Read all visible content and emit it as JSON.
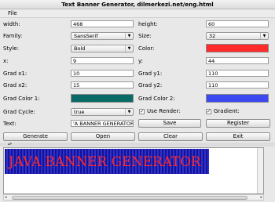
{
  "window": {
    "title": "Text Banner Generator, dilmerkezi.net/eng.html"
  },
  "menu": {
    "file": "File"
  },
  "form": {
    "width": {
      "label": "width:",
      "value": "468"
    },
    "height": {
      "label": "height:",
      "value": "60"
    },
    "family": {
      "label": "Family:",
      "value": "SansSerif"
    },
    "size": {
      "label": "Size:",
      "value": "32"
    },
    "style": {
      "label": "Style:",
      "value": "Bold"
    },
    "color": {
      "label": "Color:",
      "hex": "#ff2a2a"
    },
    "x": {
      "label": "x:",
      "value": "9"
    },
    "y": {
      "label": "y:",
      "value": "44"
    },
    "grad_x1": {
      "label": "Grad x1:",
      "value": "10"
    },
    "grad_y1": {
      "label": "Grad y1:",
      "value": "110"
    },
    "grad_x2": {
      "label": "Grad x2:",
      "value": "15"
    },
    "grad_y2": {
      "label": "Grad y2:",
      "value": "110"
    },
    "grad_color1": {
      "label": "Grad Color 1:",
      "hex": "#0a6a66"
    },
    "grad_color2": {
      "label": "Grad Color 2:",
      "hex": "#3c48f0"
    },
    "grad_cycle": {
      "label": "Grad Cycle:",
      "value": "true"
    },
    "use_render": {
      "label": "Use Render:",
      "checked": true
    },
    "gradient": {
      "label": "Gradient:",
      "checked": true
    },
    "text": {
      "label": "Text:",
      "value": "'A BANNER GENERATOR"
    }
  },
  "buttons": {
    "save": "Save",
    "register": "Register",
    "generate": "Generate",
    "open": "Open",
    "clear": "Clear",
    "exit": "Exit"
  },
  "preview": {
    "banner_text": "JAVA BANNER GENERATOR"
  }
}
